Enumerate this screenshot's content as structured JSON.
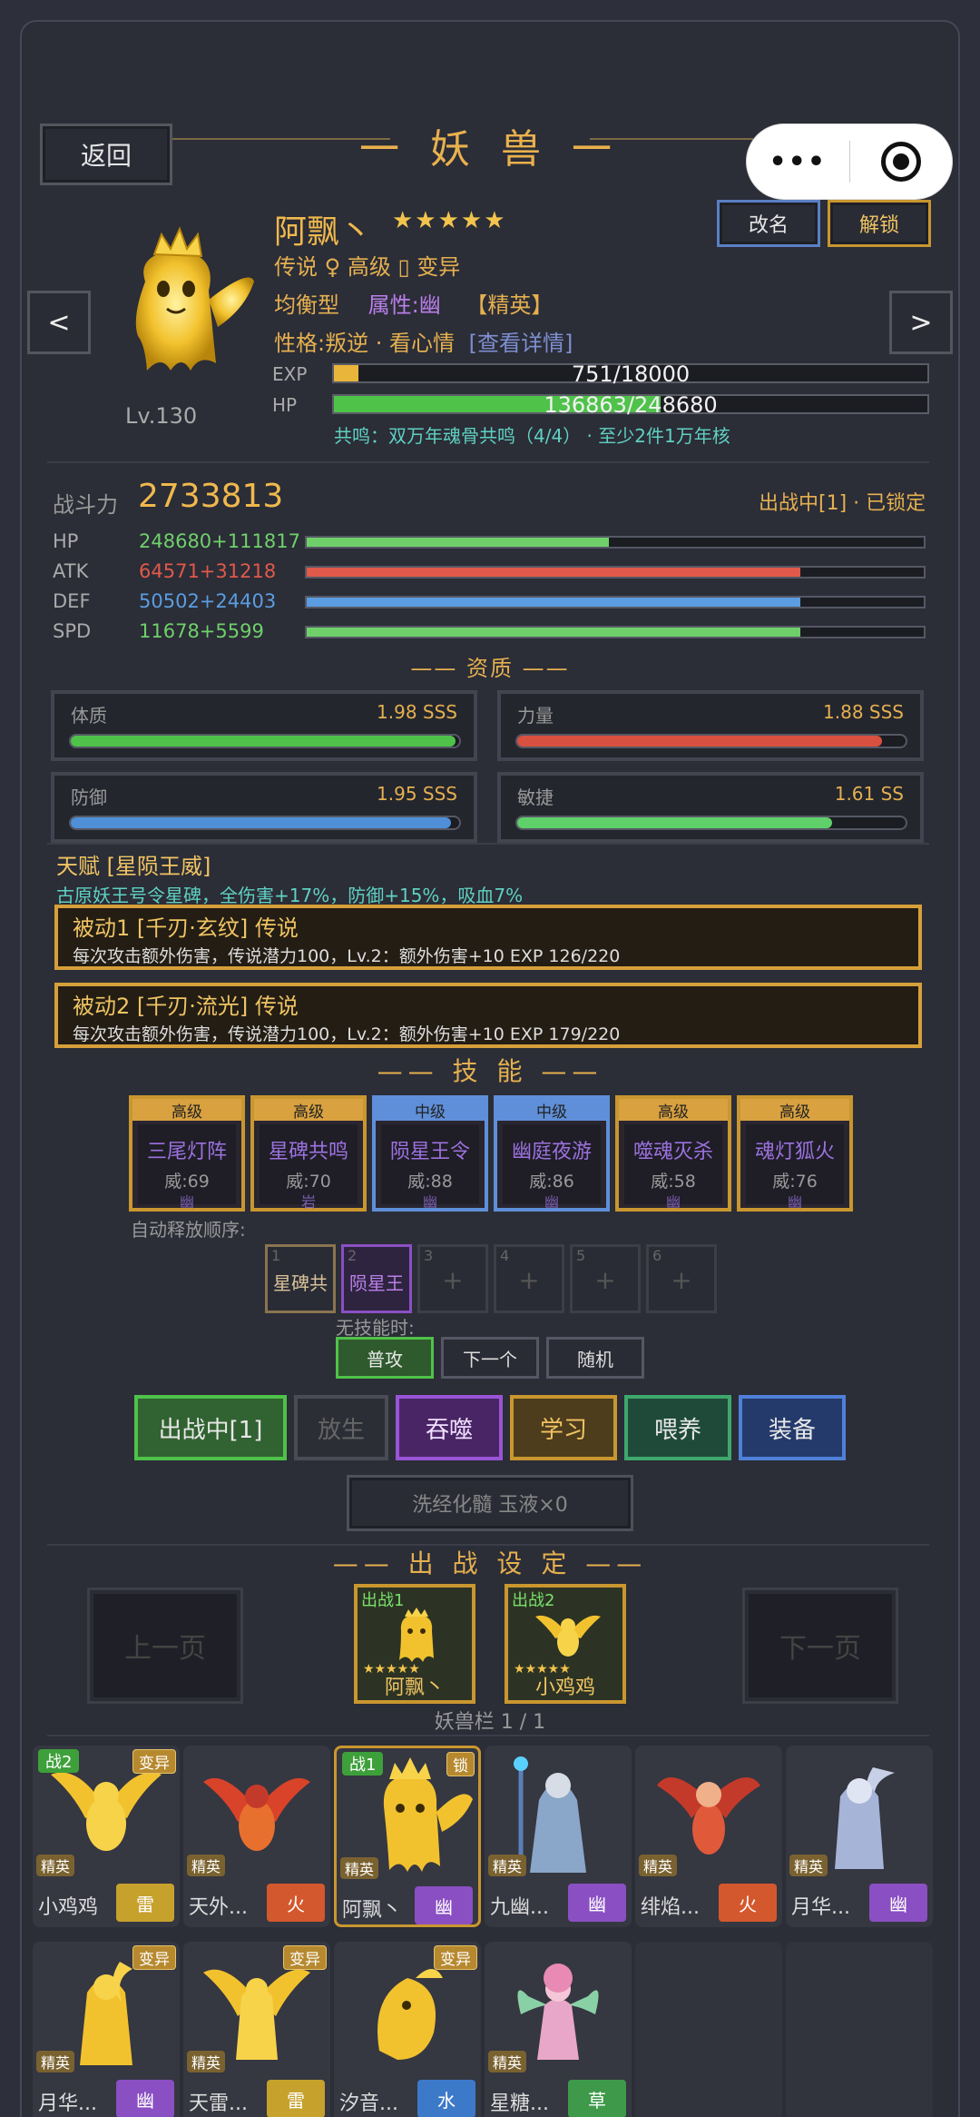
{
  "page_title": "一 妖 兽 一",
  "back_label": "返回",
  "capsule": {
    "more": "•••"
  },
  "rename_label": "改名",
  "unlock_label": "解锁",
  "prev_arrow": "<",
  "next_arrow": ">",
  "pet": {
    "name": "阿飘丶",
    "stars": "★★★★★",
    "level": "Lv.130",
    "line1": "传说 ♀ 高级 ▯ 变异",
    "type": "均衡型",
    "attr": "属性:幽",
    "rank": "【精英】",
    "personality": "性格:叛逆 · 看心情",
    "detail_link": "[查看详情]",
    "exp_label": "EXP",
    "exp_text": "751/18000",
    "exp_ratio": 0.042,
    "hp_label": "HP",
    "hp_text": "136863/248680",
    "hp_ratio": 0.55,
    "resonance": "共鸣：双万年魂骨共鸣（4/4） · 至少2件1万年核"
  },
  "power": {
    "label": "战斗力",
    "value": "2733813",
    "status": "出战中[1] · 已锁定"
  },
  "stats": [
    {
      "label": "HP",
      "value": "248680+111817",
      "color": "#6fd06a",
      "ratio": 0.49
    },
    {
      "label": "ATK",
      "value": "64571+31218",
      "color": "#e0594a",
      "ratio": 0.8
    },
    {
      "label": "DEF",
      "value": "50502+24403",
      "color": "#5b9de0",
      "ratio": 0.8
    },
    {
      "label": "SPD",
      "value": "11678+5599",
      "color": "#6fd06a",
      "ratio": 0.8
    }
  ],
  "aptitude_header": "—— 资质 ——",
  "aptitudes": [
    {
      "label": "体质",
      "value": "1.98 SSS",
      "color": "#4fc24a",
      "ratio": 0.99
    },
    {
      "label": "力量",
      "value": "1.88 SSS",
      "color": "#d8503f",
      "ratio": 0.94
    },
    {
      "label": "防御",
      "value": "1.95 SSS",
      "color": "#4f8fd8",
      "ratio": 0.98
    },
    {
      "label": "敏捷",
      "value": "1.61 SS",
      "color": "#5fd06a",
      "ratio": 0.81
    }
  ],
  "talent": {
    "title": "天赋 [星陨王威]",
    "desc": "古原妖王号令星碑，全伤害+17%，防御+15%，吸血7%"
  },
  "passives": [
    {
      "title": "被动1 [千刃·玄纹] 传说",
      "desc": "每次攻击额外伤害，传说潜力100，Lv.2：额外伤害+10  EXP 126/220"
    },
    {
      "title": "被动2 [千刃·流光] 传说",
      "desc": "每次攻击额外伤害，传说潜力100，Lv.2：额外伤害+10  EXP 179/220"
    }
  ],
  "skills_header": "—— 技 能 ——",
  "skills": [
    {
      "tier": "高级",
      "name": "三尾灯阵",
      "power": "威:69",
      "element": "幽",
      "blue": false
    },
    {
      "tier": "高级",
      "name": "星碑共鸣",
      "power": "威:70",
      "element": "岩",
      "blue": false
    },
    {
      "tier": "中级",
      "name": "陨星王令",
      "power": "威:88",
      "element": "幽",
      "blue": true
    },
    {
      "tier": "中级",
      "name": "幽庭夜游",
      "power": "威:86",
      "element": "幽",
      "blue": true
    },
    {
      "tier": "高级",
      "name": "噬魂灭杀",
      "power": "威:58",
      "element": "幽",
      "blue": false
    },
    {
      "tier": "高级",
      "name": "魂灯狐火",
      "power": "威:76",
      "element": "幽",
      "blue": false
    }
  ],
  "auto_label": "自动释放顺序:",
  "auto_slots": [
    {
      "n": "1",
      "s": "星碑共"
    },
    {
      "n": "2",
      "s": "陨星王"
    },
    {
      "n": "3",
      "s": "+"
    },
    {
      "n": "4",
      "s": "+"
    },
    {
      "n": "5",
      "s": "+"
    },
    {
      "n": "6",
      "s": "+"
    }
  ],
  "noskill_label": "无技能时:",
  "modes": [
    "普攻",
    "下一个",
    "随机"
  ],
  "actions": [
    "出战中[1]",
    "放生",
    "吞噬",
    "学习",
    "喂养",
    "装备"
  ],
  "wash_label": "洗经化髓  玉液×0",
  "battle_header": "—— 出 战 设 定 ——",
  "prev_page": "上一页",
  "next_page": "下一页",
  "battle_slots": [
    {
      "tag": "出战1",
      "stars": "★★★★★",
      "name": "阿飘丶"
    },
    {
      "tag": "出战2",
      "stars": "★★★★★",
      "name": "小鸡鸡"
    }
  ],
  "slot_count": "妖兽栏 1 / 1",
  "pets": [
    {
      "name": "小鸡鸡",
      "element": "雷",
      "color": "#c6a12c",
      "battle": "战2",
      "badge": "变异",
      "elite": "精英",
      "sel": false
    },
    {
      "name": "天外...",
      "element": "火",
      "color": "#d4582d",
      "battle": "",
      "badge": "",
      "elite": "精英",
      "sel": false
    },
    {
      "name": "阿飘丶",
      "element": "幽",
      "color": "#8a4fc2",
      "battle": "战1",
      "badge": "锁",
      "elite": "精英",
      "sel": true
    },
    {
      "name": "九幽...",
      "element": "幽",
      "color": "#8a4fc2",
      "battle": "",
      "badge": "",
      "elite": "精英",
      "sel": false
    },
    {
      "name": "绯焰...",
      "element": "火",
      "color": "#d4582d",
      "battle": "",
      "badge": "",
      "elite": "精英",
      "sel": false
    },
    {
      "name": "月华...",
      "element": "幽",
      "color": "#8a4fc2",
      "battle": "",
      "badge": "",
      "elite": "精英",
      "sel": false
    },
    {
      "name": "月华...",
      "element": "幽",
      "color": "#8a4fc2",
      "battle": "",
      "badge": "变异",
      "elite": "精英",
      "sel": false
    },
    {
      "name": "天雷...",
      "element": "雷",
      "color": "#c6a12c",
      "battle": "",
      "badge": "变异",
      "elite": "精英",
      "sel": false
    },
    {
      "name": "汐音...",
      "element": "水",
      "color": "#3d79c9",
      "battle": "",
      "badge": "变异",
      "elite": "",
      "sel": false
    },
    {
      "name": "星糖...",
      "element": "草",
      "color": "#3e9a4a",
      "battle": "",
      "badge": "",
      "elite": "精英",
      "sel": false
    }
  ]
}
